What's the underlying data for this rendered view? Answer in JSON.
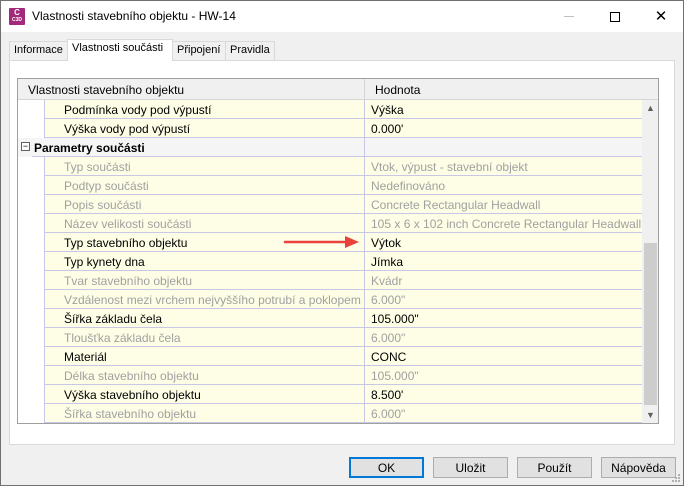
{
  "window": {
    "title": "Vlastnosti stavebního objektu - HW-14",
    "app_icon_letter": "C",
    "app_icon_sub": "C3D",
    "close_glyph": "✕"
  },
  "tabs": [
    {
      "label": "Informace"
    },
    {
      "label": "Vlastnosti součásti"
    },
    {
      "label": "Připojení"
    },
    {
      "label": "Pravidla"
    }
  ],
  "grid": {
    "header_name": "Vlastnosti stavebního objektu",
    "header_value": "Hodnota",
    "rows": [
      {
        "name": "Podmínka vody pod výpustí",
        "value": "Výška",
        "enabled": true
      },
      {
        "name": "Výška vody pod výpustí",
        "value": "0.000'",
        "enabled": true
      },
      {
        "name": "Parametry součásti",
        "value": "",
        "category": true,
        "expander": "−"
      },
      {
        "name": "Typ součásti",
        "value": "Vtok, výpust - stavební objekt",
        "enabled": false
      },
      {
        "name": "Podtyp součásti",
        "value": "Nedefinováno",
        "enabled": false
      },
      {
        "name": "Popis součásti",
        "value": "Concrete Rectangular Headwall",
        "enabled": false
      },
      {
        "name": "Název velikosti součásti",
        "value": "105 x 6 x 102 inch Concrete Rectangular Headwall",
        "enabled": false
      },
      {
        "name": "Typ stavebního objektu",
        "value": "Výtok",
        "enabled": true
      },
      {
        "name": "Typ kynety dna",
        "value": "Jímka",
        "enabled": true
      },
      {
        "name": "Tvar stavebního objektu",
        "value": "Kvádr",
        "enabled": false
      },
      {
        "name": "Vzdálenost mezi vrchem nejvyššího potrubí a poklopem",
        "value": "6.000\"",
        "enabled": false
      },
      {
        "name": "Šířka základu čela",
        "value": "105.000\"",
        "enabled": true
      },
      {
        "name": "Tloušťka základu čela",
        "value": "6.000\"",
        "enabled": false
      },
      {
        "name": "Materiál",
        "value": "CONC",
        "enabled": true
      },
      {
        "name": "Délka stavebního objektu",
        "value": "105.000\"",
        "enabled": false
      },
      {
        "name": "Výška stavebního objektu",
        "value": "8.500'",
        "enabled": true
      },
      {
        "name": "Šířka stavebního objektu",
        "value": "6.000\"",
        "enabled": false
      }
    ]
  },
  "scrollbar": {
    "up_glyph": "▲",
    "down_glyph": "▼"
  },
  "buttons": {
    "ok": "OK",
    "save": "Uložit",
    "apply": "Použít",
    "help": "Nápověda"
  },
  "colors": {
    "editable_row_bg": "#fefee6",
    "disabled_text": "#a0a0a0",
    "annotation_arrow": "#e8423a"
  }
}
